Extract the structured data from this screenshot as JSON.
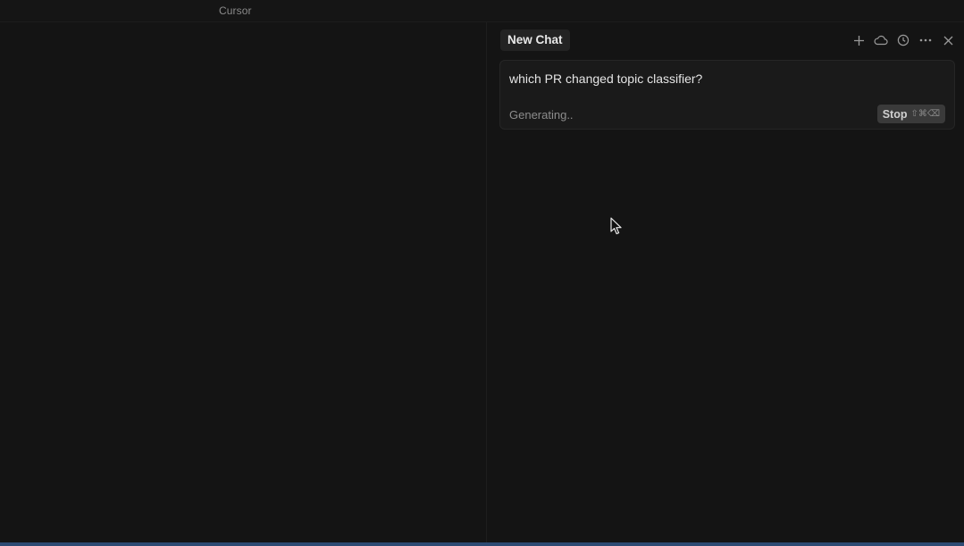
{
  "window": {
    "title": "Cursor"
  },
  "chat": {
    "tab_label": "New Chat",
    "actions": [
      {
        "name": "new-chat",
        "icon": "plus-icon"
      },
      {
        "name": "cloud",
        "icon": "cloud-icon"
      },
      {
        "name": "history",
        "icon": "history-icon"
      },
      {
        "name": "more",
        "icon": "more-icon"
      },
      {
        "name": "close",
        "icon": "close-icon"
      }
    ],
    "message": {
      "text": "which PR changed topic classifier?",
      "status": "Generating..",
      "stop_label": "Stop",
      "stop_shortcut": "⇧⌘⌫"
    }
  },
  "colors": {
    "background": "#141414",
    "panel": "#1a1a1a",
    "accent_bar": "#2d4a73"
  }
}
